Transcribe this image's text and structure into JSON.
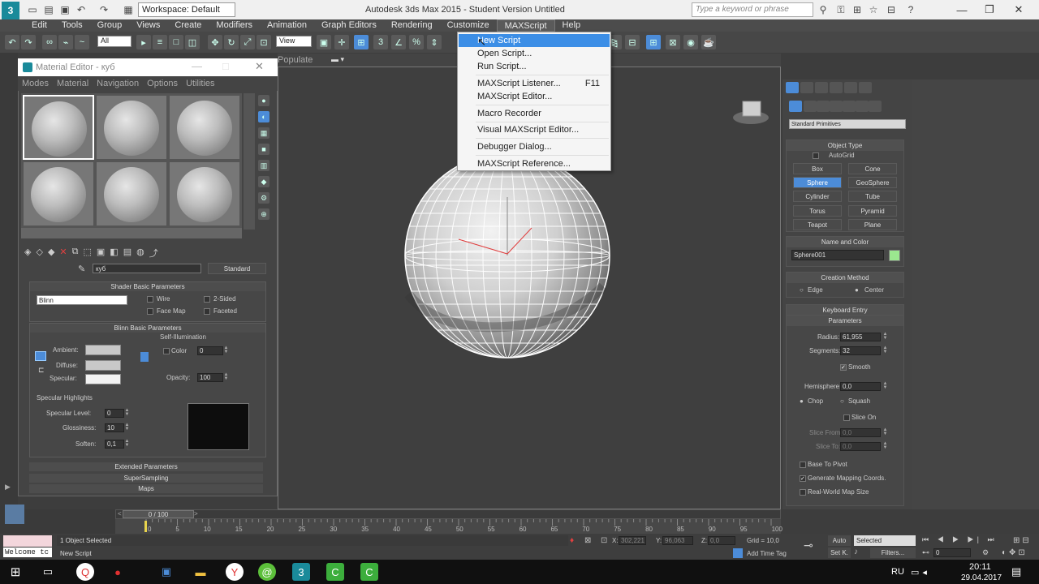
{
  "window": {
    "workspace": "Workspace: Default",
    "title": "Autodesk 3ds Max  2015   -  Student Version    Untitled",
    "search_placeholder": "Type a keyword or phrase"
  },
  "menu": [
    "Edit",
    "Tools",
    "Group",
    "Views",
    "Create",
    "Modifiers",
    "Animation",
    "Graph Editors",
    "Rendering",
    "Customize",
    "MAXScript",
    "Help"
  ],
  "toolbar": {
    "selection_filter": "All",
    "ref_coord": "View",
    "populate": "Populate"
  },
  "maxscript_menu": {
    "items": [
      {
        "label": "New Script",
        "shortcut": ""
      },
      {
        "label": "Open Script...",
        "shortcut": ""
      },
      {
        "label": "Run Script...",
        "shortcut": ""
      },
      {
        "label": "MAXScript Listener...",
        "shortcut": "F11"
      },
      {
        "label": "MAXScript Editor...",
        "shortcut": ""
      },
      {
        "label": "Macro Recorder",
        "shortcut": ""
      },
      {
        "label": "Visual MAXScript Editor...",
        "shortcut": ""
      },
      {
        "label": "Debugger Dialog...",
        "shortcut": ""
      },
      {
        "label": "MAXScript Reference...",
        "shortcut": ""
      }
    ],
    "highlighted": "New Script"
  },
  "material_editor": {
    "title": "Material Editor - куб",
    "menu": [
      "Modes",
      "Material",
      "Navigation",
      "Options",
      "Utilities"
    ],
    "material_name": "куб",
    "material_type": "Standard",
    "shader_params": {
      "header": "Shader Basic Parameters",
      "shader": "Blinn",
      "wire": "Wire",
      "two_sided": "2-Sided",
      "face_map": "Face Map",
      "faceted": "Faceted"
    },
    "blinn_params": {
      "header": "Blinn Basic Parameters",
      "self_illum": "Self-Illumination",
      "ambient": "Ambient:",
      "diffuse": "Diffuse:",
      "specular": "Specular:",
      "color_label": "Color",
      "color_value": "0",
      "opacity_label": "Opacity:",
      "opacity_value": "100"
    },
    "specular_highlights": {
      "header": "Specular Highlights",
      "level_label": "Specular Level:",
      "level": "0",
      "gloss_label": "Glossiness:",
      "gloss": "10",
      "soften_label": "Soften:",
      "soften": "0,1"
    },
    "rollouts": [
      "Extended Parameters",
      "SuperSampling",
      "Maps"
    ]
  },
  "command_panel": {
    "category": "Standard Primitives",
    "object_type_header": "Object Type",
    "autogrid": "AutoGrid",
    "buttons": [
      "Box",
      "Cone",
      "Sphere",
      "GeoSphere",
      "Cylinder",
      "Tube",
      "Torus",
      "Pyramid",
      "Teapot",
      "Plane"
    ],
    "selected_button": "Sphere",
    "name_color_header": "Name and Color",
    "object_name": "Sphere001",
    "object_color": "#9be78f",
    "creation_method_header": "Creation Method",
    "edge": "Edge",
    "center": "Center",
    "keyboard_entry": "Keyboard Entry",
    "parameters_header": "Parameters",
    "radius_label": "Radius:",
    "radius": "61,955",
    "segments_label": "Segments:",
    "segments": "32",
    "smooth": "Smooth",
    "hemisphere_label": "Hemisphere:",
    "hemisphere": "0,0",
    "chop": "Chop",
    "squash": "Squash",
    "slice_on": "Slice On",
    "slice_from_label": "Slice From:",
    "slice_from": "0,0",
    "slice_to_label": "Slice To:",
    "slice_to": "0,0",
    "base_to_pivot": "Base To Pivot",
    "gen_mapping": "Generate Mapping Coords.",
    "real_world": "Real-World Map Size"
  },
  "timeline": {
    "frame": "0 / 100",
    "ticks": [
      "0",
      "5",
      "10",
      "15",
      "20",
      "25",
      "30",
      "35",
      "40",
      "45",
      "50",
      "55",
      "60",
      "65",
      "70",
      "75",
      "80",
      "85",
      "90",
      "95",
      "100"
    ]
  },
  "status": {
    "listener": "Welcome tc",
    "selected": "1 Object Selected",
    "prompt": "New Script",
    "x_label": "X:",
    "x": "302,221",
    "y_label": "Y:",
    "y": "96,063",
    "z_label": "Z:",
    "z": "0,0",
    "grid": "Grid = 10,0",
    "add_time_tag": "Add Time Tag",
    "auto": "Auto",
    "set_k": "Set K.",
    "selected_dd": "Selected",
    "filters": "Filters...",
    "frame_field": "0"
  },
  "taskbar": {
    "lang": "RU",
    "time": "20:11",
    "date": "29.04.2017"
  }
}
